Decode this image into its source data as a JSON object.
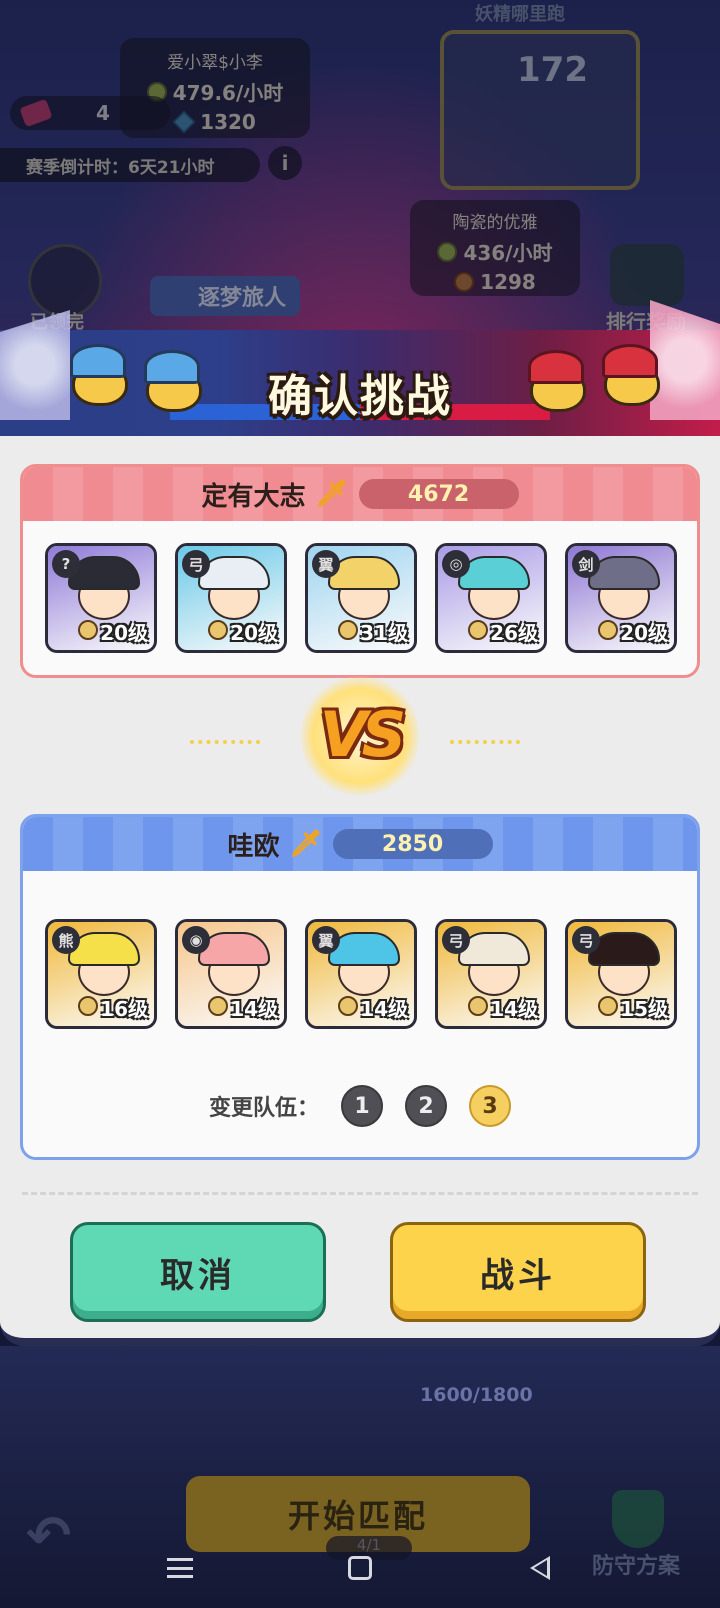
{
  "background": {
    "player_name": "爱小翠$小李",
    "player_rate": "479.6/小时",
    "player_gems": "1320",
    "tickets": "4",
    "season_countdown": "赛季倒计时：6天21小时",
    "info": "i",
    "top_name": "妖精哪里跑",
    "rank_number": "172",
    "opponent_name": "陶瓷的优雅",
    "opponent_rate": "436/小时",
    "opponent_medals": "1298",
    "dream_label": "逐梦旅人",
    "claimed_label": "已领完",
    "reward_label": "排行奖励",
    "progress": "1600/1800",
    "match_button": "开始匹配",
    "match_sub": "4/1",
    "defense_label": "防守方案"
  },
  "dialog": {
    "title": "确认挑战",
    "enemy_team": {
      "name": "定有大志",
      "power": "4672",
      "heroes": [
        {
          "class_icon": "?",
          "level": "20级",
          "hair": "#2b2b36",
          "bg": "#8f7ad8"
        },
        {
          "class_icon": "弓",
          "level": "20级",
          "hair": "#e8eef4",
          "bg": "#6ac8e8"
        },
        {
          "class_icon": "翼",
          "level": "31级",
          "hair": "#f4d26a",
          "bg": "#9fd4f0"
        },
        {
          "class_icon": "◎",
          "level": "26级",
          "hair": "#5ad0d6",
          "bg": "#a99be6"
        },
        {
          "class_icon": "剑",
          "level": "20级",
          "hair": "#6e6e88",
          "bg": "#8e77d4"
        }
      ]
    },
    "vs_text": "VS",
    "my_team": {
      "name": "哇欧",
      "power": "2850",
      "heroes": [
        {
          "class_icon": "熊",
          "level": "16级",
          "hair": "#f6e04a",
          "bg": "#f0b83a"
        },
        {
          "class_icon": "◉",
          "level": "14级",
          "hair": "#f6a6a6",
          "bg": "#f6c68c"
        },
        {
          "class_icon": "翼",
          "level": "14级",
          "hair": "#4ec4e6",
          "bg": "#f0b83a"
        },
        {
          "class_icon": "弓",
          "level": "14级",
          "hair": "#f0e8d8",
          "bg": "#f0b83a"
        },
        {
          "class_icon": "弓",
          "level": "15级",
          "hair": "#2a1a1a",
          "bg": "#f0b83a"
        }
      ]
    },
    "switch_label": "变更队伍：",
    "team_slots": [
      "1",
      "2",
      "3"
    ],
    "active_slot": "3",
    "cancel_button": "取消",
    "fight_button": "战斗"
  }
}
